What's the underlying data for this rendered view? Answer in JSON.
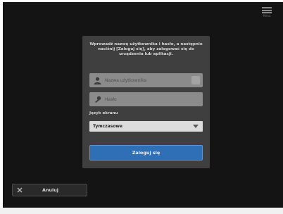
{
  "menu": {
    "icon": "menu-icon",
    "caption": "Menu"
  },
  "login": {
    "warning": "Wprowadź nazwę użytkownika i hasło, a następnie naciśnij [Zaloguj się], aby zalogować się do urządzenia lub aplikacji.",
    "username_placeholder": "Nazwa użytkownika",
    "password_placeholder": "Hasło",
    "language_label": "Język ekranu",
    "language_value": "Tymczasowe",
    "submit_label": "Zaloguj się"
  },
  "footer": {
    "cancel_label": "Anuluj"
  }
}
